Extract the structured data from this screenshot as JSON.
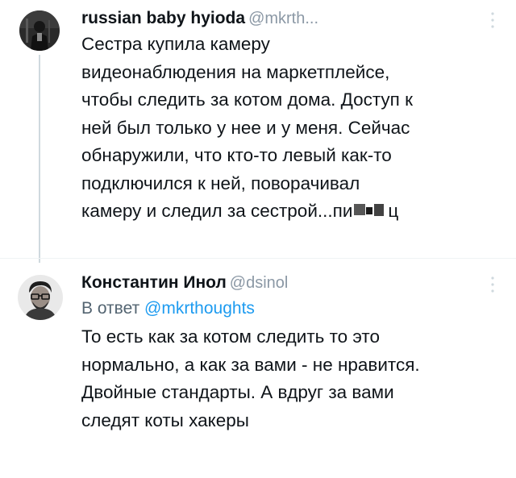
{
  "tweets": [
    {
      "display_name": "russian baby hyioda",
      "handle": "@mkrth...",
      "avatar_icon": "profile-photo-dark",
      "more_icon": "more-vertical-icon",
      "text_lines": [
        "Сестра купила камеру",
        "видеонаблюдения на маркетплейсе,",
        "чтобы следить за котом дома. Доступ к",
        "ней был только у нее и у меня. Сейчас",
        "обнаружили, что кто-то левый как-то",
        "подключился к ней, поворачивал",
        "камеру и следил за сестрой...пи",
        "ц"
      ]
    },
    {
      "display_name": "Константин Инол",
      "handle": "@dsinol",
      "avatar_icon": "profile-photo-man-glasses",
      "more_icon": "more-vertical-icon",
      "reply_prefix": "В ответ",
      "reply_handle": "@mkrthoughts",
      "text_lines": [
        "То есть как за котом следить то это",
        "нормально, а как за вами - не нравится.",
        "Двойные стандарты. А вдруг за вами",
        "следят коты хакеры"
      ]
    }
  ],
  "colors": {
    "text": "#0f1419",
    "secondary": "#536471",
    "link": "#1d9bf0",
    "thread_line": "#cfd9de"
  }
}
